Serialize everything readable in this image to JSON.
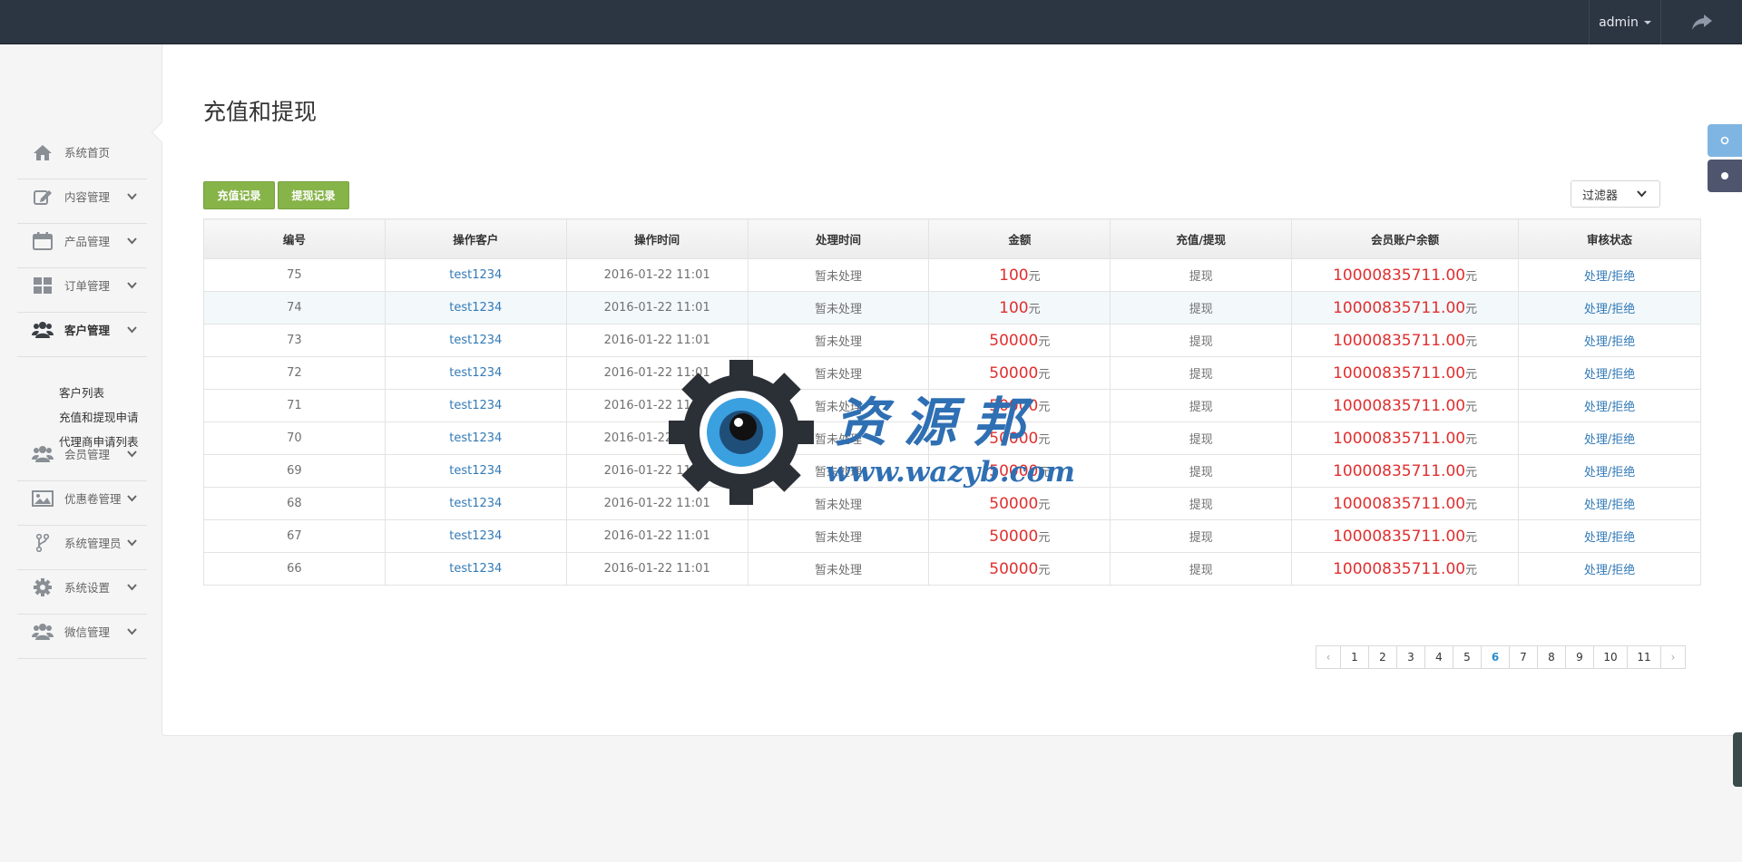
{
  "topbar": {
    "user": "admin"
  },
  "sidebar": {
    "items": [
      {
        "label": "系统首页",
        "icon": "home-icon",
        "top": 0
      },
      {
        "label": "内容管理",
        "icon": "edit-icon"
      },
      {
        "label": "产品管理",
        "icon": "calendar-icon"
      },
      {
        "label": "订单管理",
        "icon": "grid-icon"
      },
      {
        "label": "客户管理",
        "icon": "users-icon"
      },
      {
        "label": "会员管理",
        "icon": "users-icon"
      },
      {
        "label": "优惠卷管理",
        "icon": "image-icon"
      },
      {
        "label": "系统管理员",
        "icon": "fork-icon"
      },
      {
        "label": "系统设置",
        "icon": "gear-icon"
      },
      {
        "label": "微信管理",
        "icon": "users-icon"
      }
    ],
    "submenu": [
      "客户列表",
      "充值和提现申请",
      "代理商申请列表"
    ]
  },
  "page": {
    "title": "充值和提现",
    "btn_recharge": "充值记录",
    "btn_withdraw": "提现记录",
    "filter": "过滤器"
  },
  "table": {
    "headers": [
      "编号",
      "操作客户",
      "操作时间",
      "处理时间",
      "金额",
      "充值/提现",
      "会员账户余额",
      "审核状态"
    ],
    "unit": "元",
    "rows": [
      {
        "id": "75",
        "customer": "test1234",
        "time": "2016-01-22 11:01",
        "handled": "暂未处理",
        "amount": "100",
        "type": "提现",
        "balance": "10000835711.00",
        "action": "处理/拒绝"
      },
      {
        "id": "74",
        "customer": "test1234",
        "time": "2016-01-22 11:01",
        "handled": "暂未处理",
        "amount": "100",
        "type": "提现",
        "balance": "10000835711.00",
        "action": "处理/拒绝"
      },
      {
        "id": "73",
        "customer": "test1234",
        "time": "2016-01-22 11:01",
        "handled": "暂未处理",
        "amount": "50000",
        "type": "提现",
        "balance": "10000835711.00",
        "action": "处理/拒绝"
      },
      {
        "id": "72",
        "customer": "test1234",
        "time": "2016-01-22 11:01",
        "handled": "暂未处理",
        "amount": "50000",
        "type": "提现",
        "balance": "10000835711.00",
        "action": "处理/拒绝"
      },
      {
        "id": "71",
        "customer": "test1234",
        "time": "2016-01-22 11:01",
        "handled": "暂未处理",
        "amount": "50000",
        "type": "提现",
        "balance": "10000835711.00",
        "action": "处理/拒绝"
      },
      {
        "id": "70",
        "customer": "test1234",
        "time": "2016-01-22 11:01",
        "handled": "暂未处理",
        "amount": "50000",
        "type": "提现",
        "balance": "10000835711.00",
        "action": "处理/拒绝"
      },
      {
        "id": "69",
        "customer": "test1234",
        "time": "2016-01-22 11:01",
        "handled": "暂未处理",
        "amount": "50000",
        "type": "提现",
        "balance": "10000835711.00",
        "action": "处理/拒绝"
      },
      {
        "id": "68",
        "customer": "test1234",
        "time": "2016-01-22 11:01",
        "handled": "暂未处理",
        "amount": "50000",
        "type": "提现",
        "balance": "10000835711.00",
        "action": "处理/拒绝"
      },
      {
        "id": "67",
        "customer": "test1234",
        "time": "2016-01-22 11:01",
        "handled": "暂未处理",
        "amount": "50000",
        "type": "提现",
        "balance": "10000835711.00",
        "action": "处理/拒绝"
      },
      {
        "id": "66",
        "customer": "test1234",
        "time": "2016-01-22 11:01",
        "handled": "暂未处理",
        "amount": "50000",
        "type": "提现",
        "balance": "10000835711.00",
        "action": "处理/拒绝"
      }
    ]
  },
  "pager": {
    "pages": [
      "1",
      "2",
      "3",
      "4",
      "5",
      "6",
      "7",
      "8",
      "9",
      "10",
      "11"
    ],
    "current": "6",
    "prev": "‹",
    "next": "›"
  },
  "watermark": {
    "text": "资源邦",
    "url": "www.wazyb.com"
  },
  "colors": {
    "topbar": "#2c3542",
    "accent_green": "#87b449",
    "link": "#337ab7",
    "money": "#e02f2f"
  }
}
